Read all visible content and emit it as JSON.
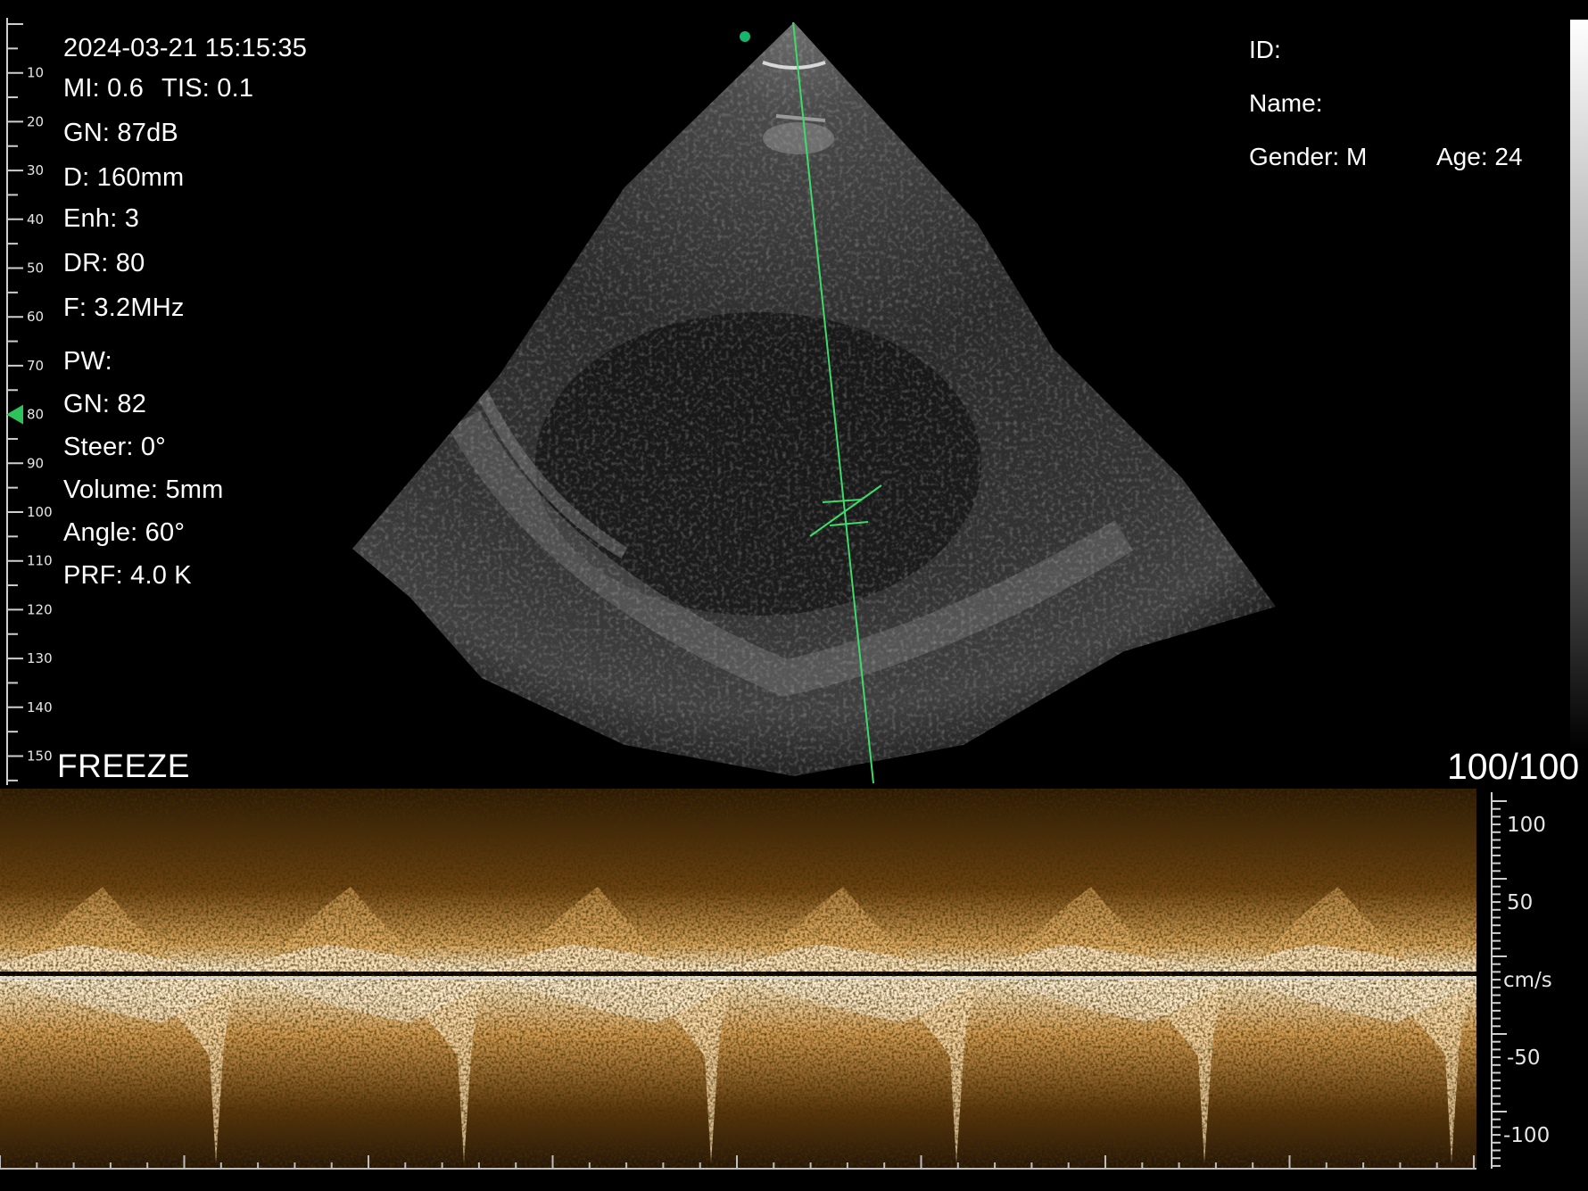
{
  "timestamp": "2024-03-21 15:15:35",
  "bmode_params": {
    "mi": "MI: 0.6",
    "tis": "TIS: 0.1",
    "gain": "GN: 87dB",
    "depth": "D: 160mm",
    "enhance": "Enh: 3",
    "dynamic_range": "DR: 80",
    "frequency": "F: 3.2MHz"
  },
  "pw_params": {
    "title": "PW:",
    "gain": "GN: 82",
    "steer": "Steer: 0°",
    "volume": "Volume: 5mm",
    "angle": "Angle: 60°",
    "prf": "PRF: 4.0 K"
  },
  "patient": {
    "id_label": "ID:",
    "name_label": "Name:",
    "gender": "Gender: M",
    "age": "Age: 24"
  },
  "status": {
    "mode": "FREEZE",
    "frame_counter": "100/100"
  },
  "depth_ruler": {
    "labels": [
      "10",
      "20",
      "30",
      "40",
      "50",
      "60",
      "70",
      "80",
      "90",
      "100",
      "110",
      "120",
      "130",
      "140",
      "150"
    ],
    "focus_marker_depth": 80
  },
  "velocity_scale": {
    "labels": [
      "100",
      "50",
      "cm/s",
      "-50",
      "-100"
    ],
    "unit": "cm/s"
  },
  "colors": {
    "marker_green": "#2ec25a",
    "text": "#ffffff",
    "spectrum_bright": "#fff0d2",
    "spectrum_mid": "#c8893a",
    "spectrum_dark": "#3a2208"
  }
}
